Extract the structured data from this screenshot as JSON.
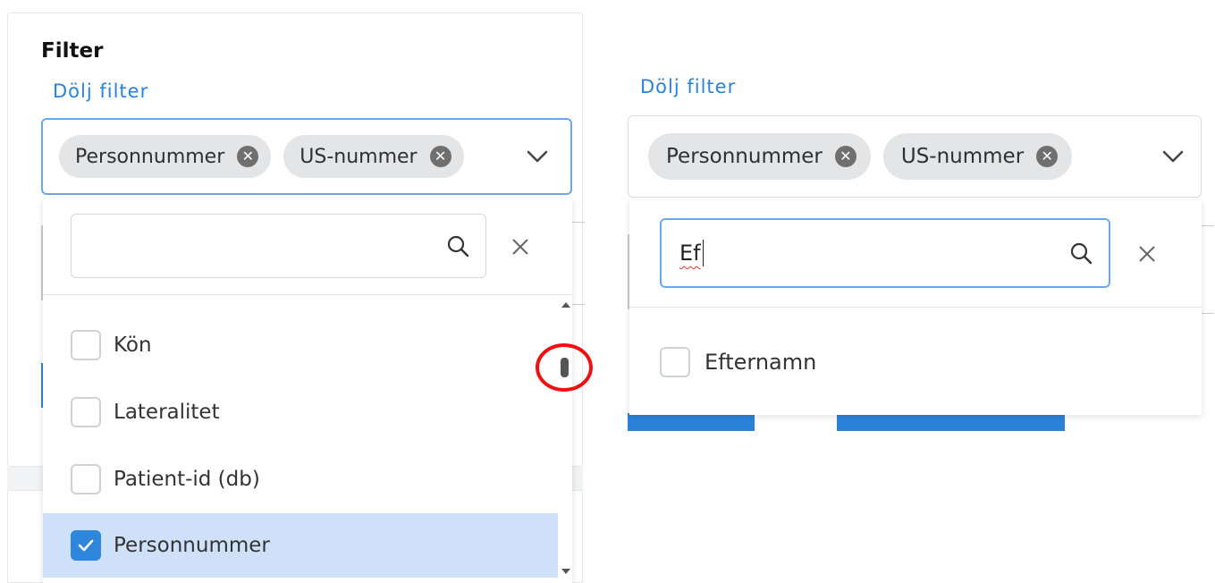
{
  "left_panel": {
    "title": "Filter",
    "hide_filter_link": "Dölj filter",
    "selected_chips": [
      {
        "label": "Personnummer"
      },
      {
        "label": "US-nummer"
      }
    ],
    "search": {
      "value": "",
      "placeholder": ""
    },
    "options": [
      {
        "label": "Kön",
        "checked": false
      },
      {
        "label": "Lateralitet",
        "checked": false
      },
      {
        "label": "Patient-id (db)",
        "checked": false
      },
      {
        "label": "Personnummer",
        "checked": true
      }
    ]
  },
  "right_panel": {
    "hide_filter_link": "Dölj filter",
    "selected_chips": [
      {
        "label": "Personnummer"
      },
      {
        "label": "US-nummer"
      }
    ],
    "search": {
      "value": "Ef"
    },
    "options": [
      {
        "label": "Efternamn",
        "checked": false
      }
    ]
  },
  "icons": {
    "chip_remove": "close-circle-icon",
    "dropdown": "chevron-down-icon",
    "search": "search-icon",
    "clear": "close-icon",
    "checkmark": "checkmark-icon"
  },
  "colors": {
    "accent": "#2b82d9",
    "focus_border": "#6ea8ea",
    "selected_row": "#cfe1f8",
    "chip_bg": "#e4e5e7",
    "annotation": "#ee1111"
  }
}
